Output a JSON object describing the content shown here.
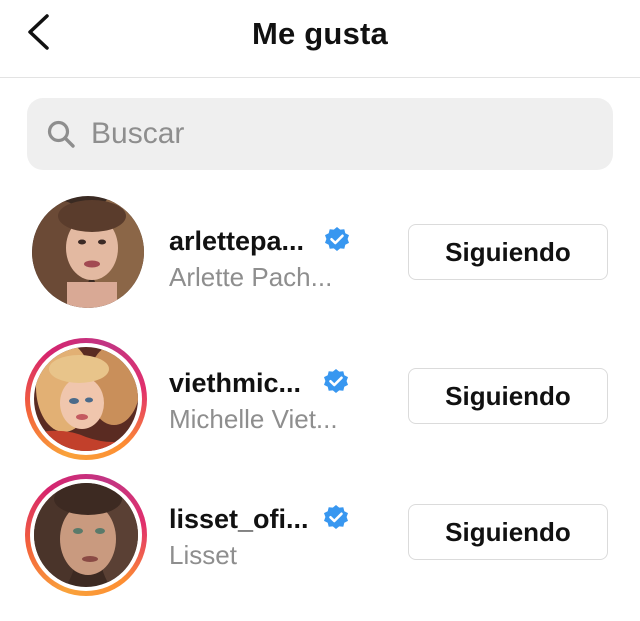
{
  "header": {
    "title": "Me gusta",
    "back_icon": "chevron-left-icon"
  },
  "search": {
    "placeholder": "Buscar",
    "value": "",
    "icon": "search-icon"
  },
  "colors": {
    "verified": "#3897f0",
    "secondary_text": "#8e8e8e",
    "search_bg": "#efefef"
  },
  "users": [
    {
      "username": "arlettepa...",
      "full_name": "Arlette Pach...",
      "verified": true,
      "story_ring": false,
      "button_label": "Siguiendo"
    },
    {
      "username": "viethmic...",
      "full_name": "Michelle Viet...",
      "verified": true,
      "story_ring": true,
      "button_label": "Siguiendo"
    },
    {
      "username": "lisset_ofi...",
      "full_name": "Lisset",
      "verified": true,
      "story_ring": true,
      "button_label": "Siguiendo"
    }
  ]
}
